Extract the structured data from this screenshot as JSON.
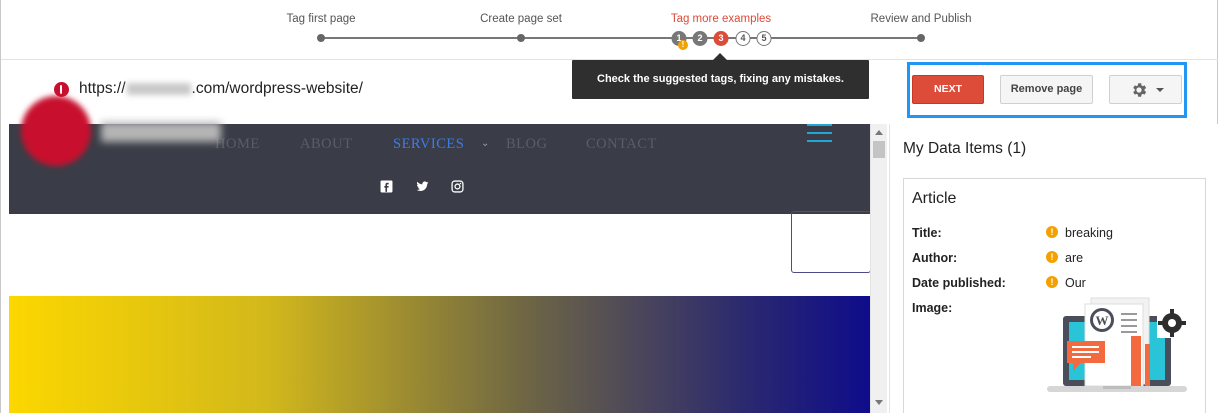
{
  "stepper": {
    "steps": [
      {
        "label": "Tag first page"
      },
      {
        "label": "Create page set"
      },
      {
        "label": "Tag more examples",
        "active": true
      },
      {
        "label": "Review and Publish"
      }
    ],
    "substeps": [
      "1",
      "2",
      "3",
      "4",
      "5"
    ],
    "current_substep": "3"
  },
  "tooltip": {
    "text": "Check the suggested tags, fixing any mistakes."
  },
  "url": {
    "prefix": "https://",
    "suffix": ".com/wordpress-website/"
  },
  "actions": {
    "next_label": "NEXT",
    "remove_label": "Remove page",
    "accent_color": "#dd4b39",
    "highlight_color": "#2196f3"
  },
  "website": {
    "nav": [
      "HOME",
      "ABOUT",
      "SERVICES",
      "BLOG",
      "CONTACT"
    ],
    "active_nav": "SERVICES",
    "social": [
      "facebook-icon",
      "twitter-icon",
      "instagram-icon"
    ]
  },
  "panel": {
    "title": "My Data Items (1)",
    "card_title": "Article",
    "fields": [
      {
        "label": "Title:",
        "value": "breaking",
        "warning": true
      },
      {
        "label": "Author:",
        "value": "are",
        "warning": true
      },
      {
        "label": "Date published:",
        "value": "Our",
        "warning": true
      },
      {
        "label": "Image:",
        "value": "",
        "warning": false
      }
    ]
  }
}
